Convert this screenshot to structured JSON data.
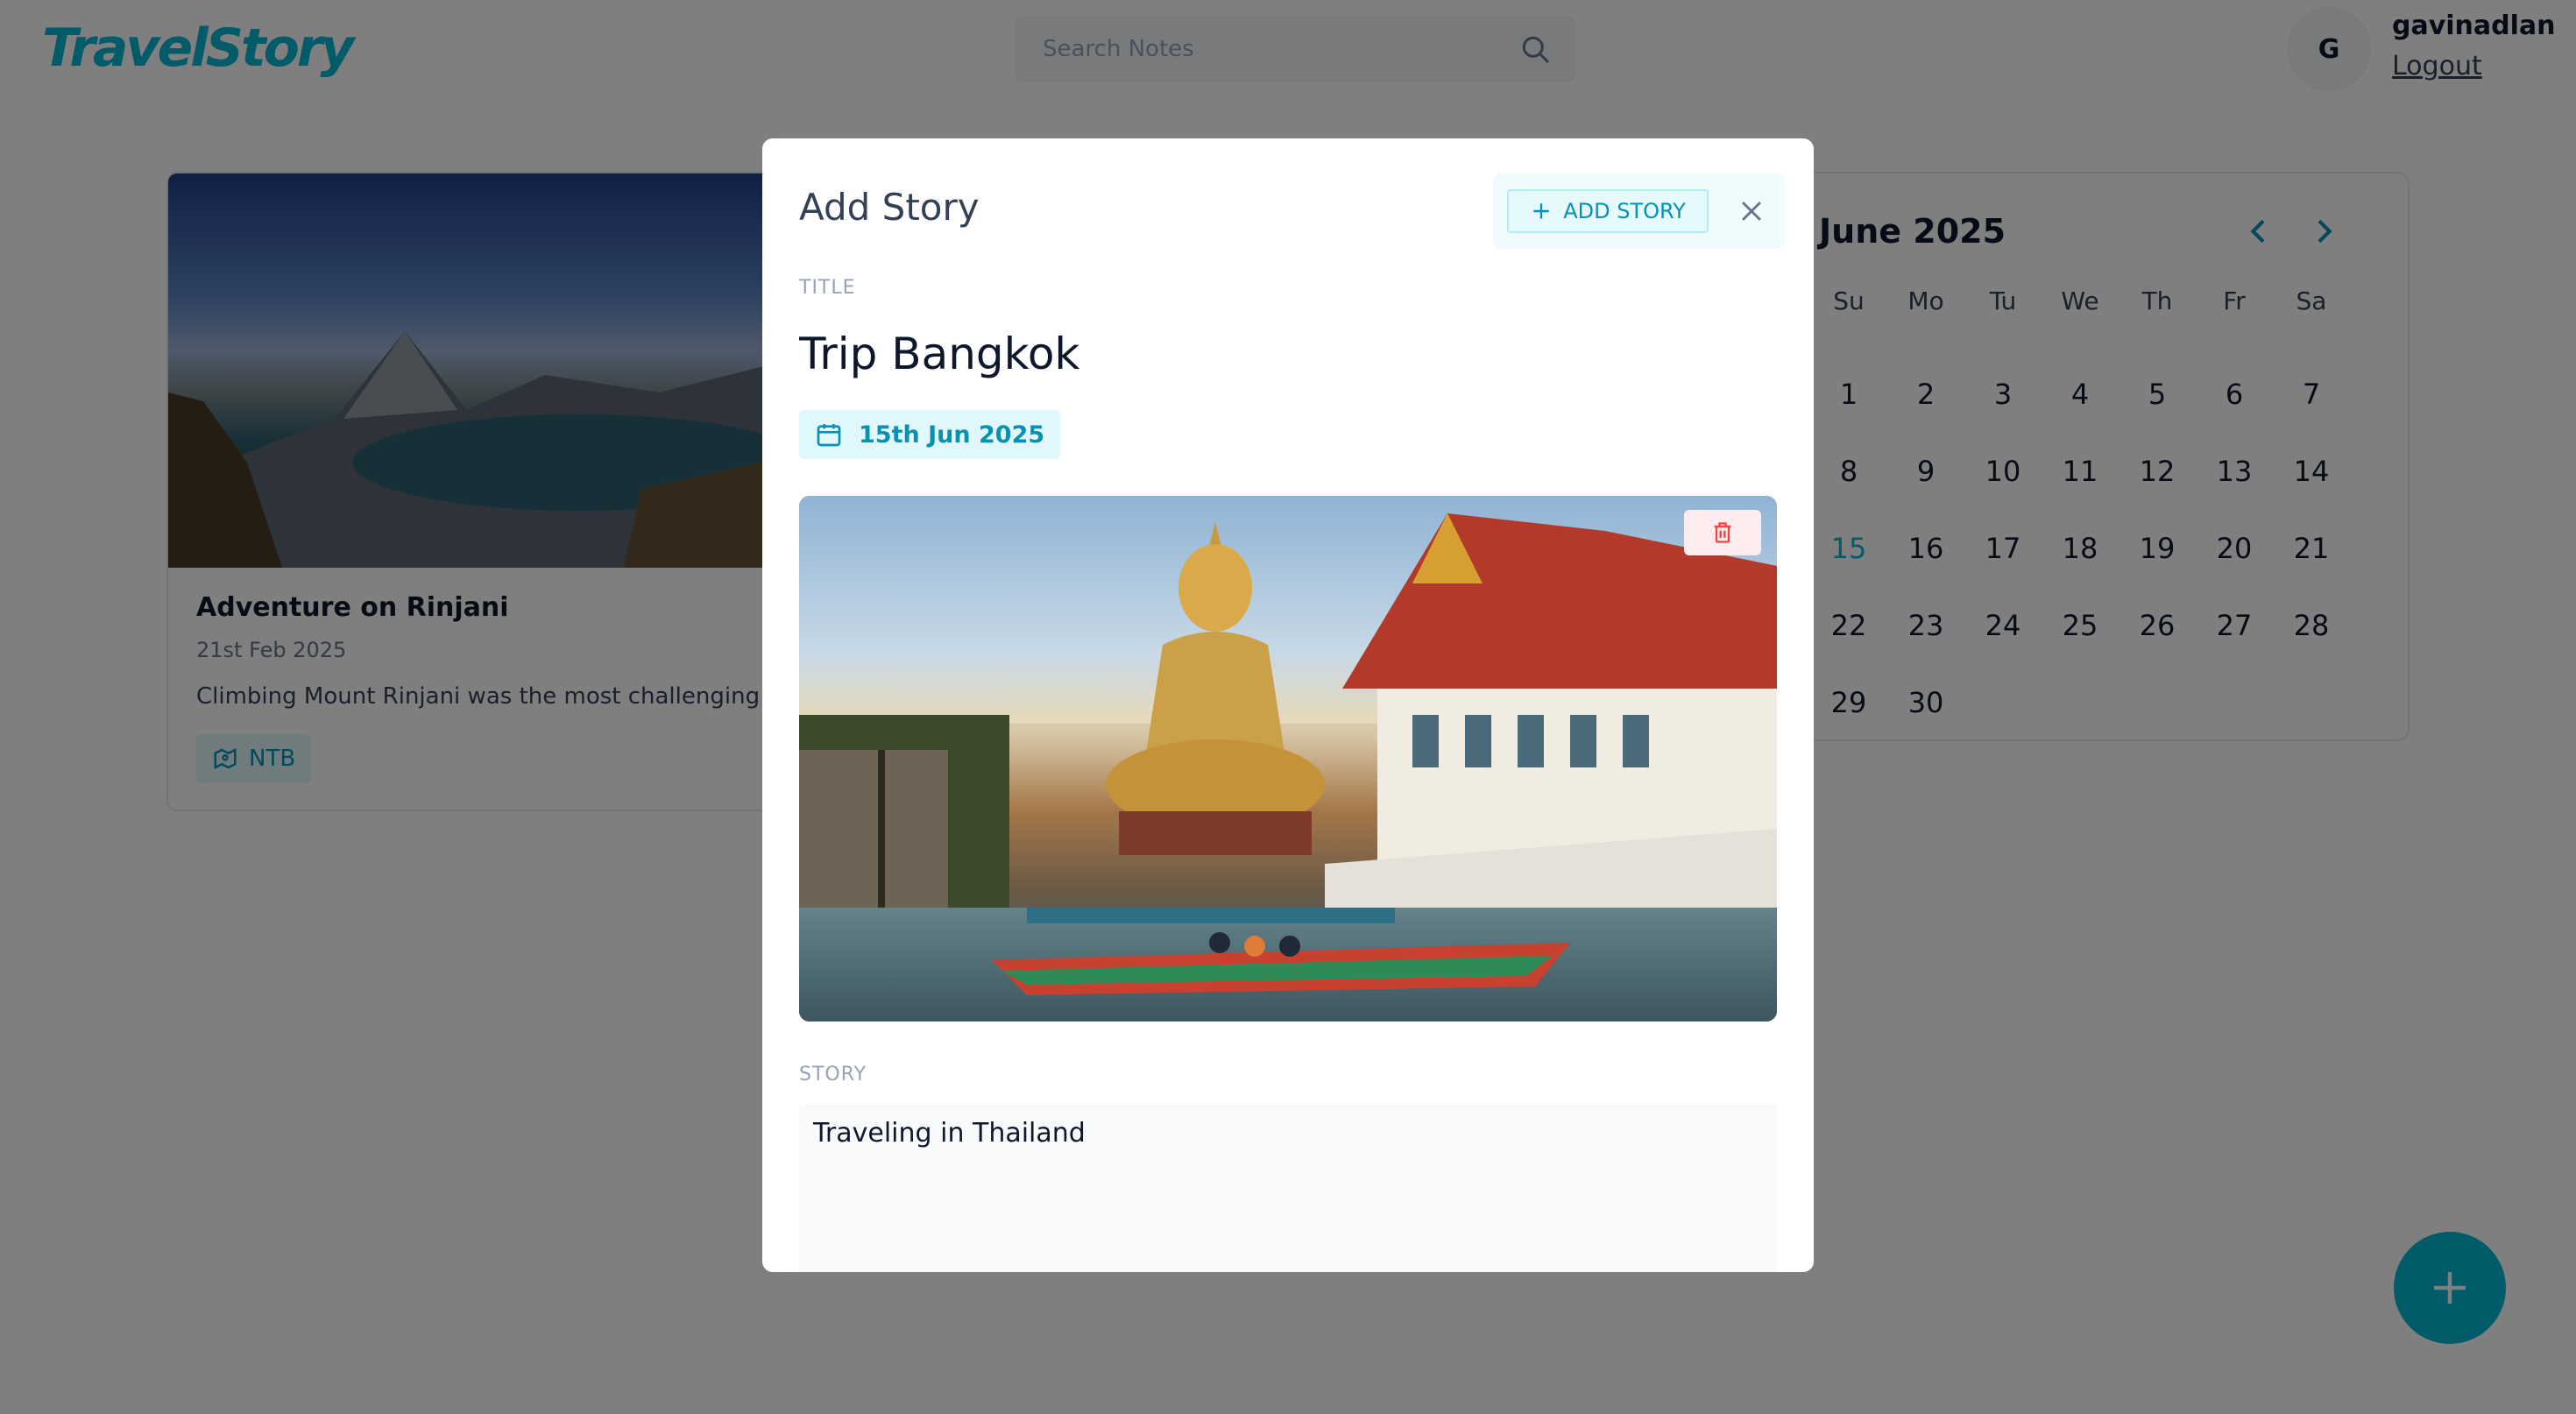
{
  "header": {
    "logo": "TravelStory",
    "search_placeholder": "Search Notes",
    "avatar_initial": "G",
    "username": "gavinadlan",
    "logout_label": "Logout"
  },
  "story_card": {
    "title": "Adventure on Rinjani",
    "date": "21st Feb 2025",
    "excerpt": "Climbing Mount Rinjani was the most challenging yet r",
    "location": "NTB"
  },
  "calendar": {
    "month": "June",
    "year": "2025",
    "weekdays": [
      "Su",
      "Mo",
      "Tu",
      "We",
      "Th",
      "Fr",
      "Sa"
    ],
    "days": [
      "1",
      "2",
      "3",
      "4",
      "5",
      "6",
      "7",
      "8",
      "9",
      "10",
      "11",
      "12",
      "13",
      "14",
      "15",
      "16",
      "17",
      "18",
      "19",
      "20",
      "21",
      "22",
      "23",
      "24",
      "25",
      "26",
      "27",
      "28",
      "29",
      "30"
    ],
    "selected_day": "15"
  },
  "modal": {
    "title": "Add Story",
    "add_button_label": "ADD STORY",
    "title_label": "TITLE",
    "title_value": "Trip Bangkok",
    "date_label": "15th Jun 2025",
    "story_label": "STORY",
    "story_value": "Traveling in Thailand"
  },
  "colors": {
    "accent": "#05b6d3",
    "danger": "#ef4444"
  }
}
